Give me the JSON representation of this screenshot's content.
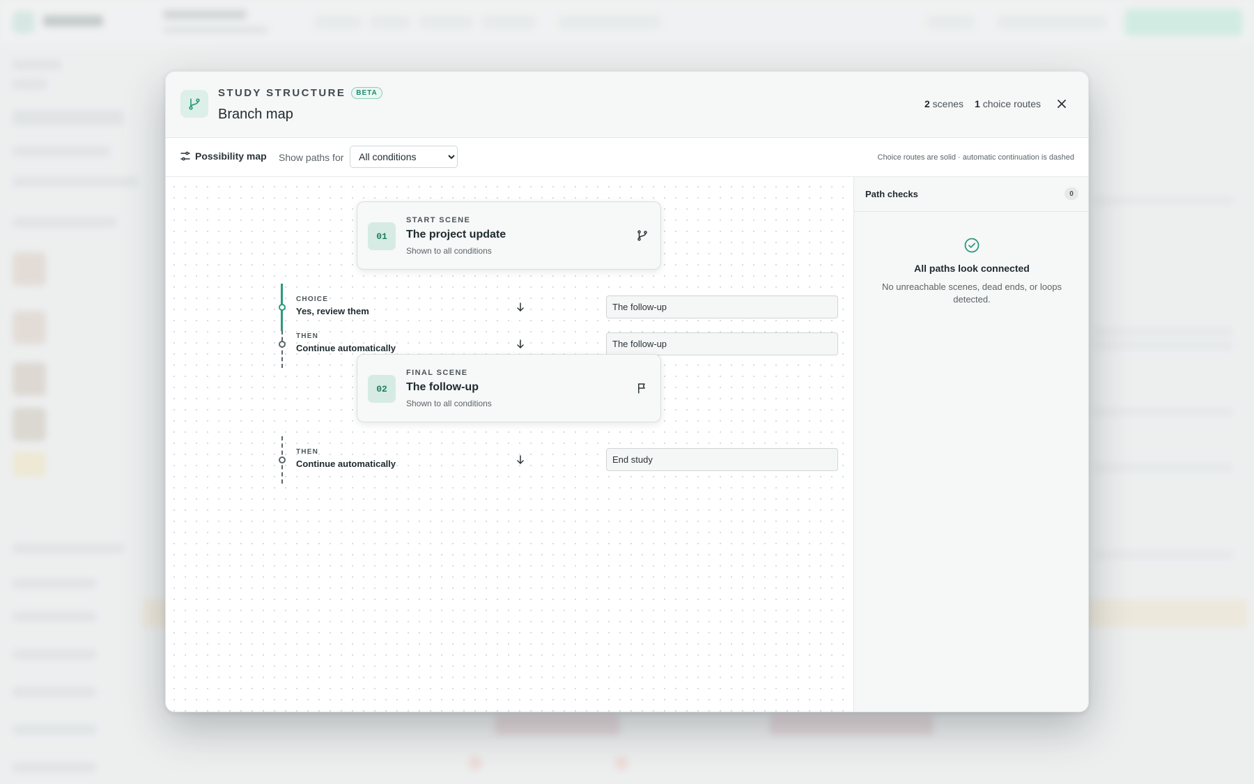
{
  "colors": {
    "accent": "#2a9a7c",
    "accent_soft": "#dcefe8",
    "text": "#1f2a2e",
    "muted": "#5a6468"
  },
  "modal": {
    "icon": "branch-icon",
    "eyebrow": "STUDY STRUCTURE",
    "badge": "BETA",
    "title": "Branch map",
    "stats": {
      "scenes_count": "2",
      "scenes_label": "scenes",
      "routes_count": "1",
      "routes_label": "choice routes"
    },
    "close_icon": "close-icon"
  },
  "toolbar": {
    "map_icon": "sliders-icon",
    "map_label": "Possibility map",
    "filter_label": "Show paths for",
    "filter_selected": "All conditions",
    "filter_options": [
      "All conditions"
    ],
    "legend_hint": "Choice routes are solid · automatic continuation is dashed"
  },
  "canvas": {
    "scenes": [
      {
        "number": "01",
        "kicker": "START SCENE",
        "name": "The project update",
        "subtitle": "Shown to all conditions",
        "icon": "branch-icon",
        "routes": [
          {
            "kind": "CHOICE",
            "label": "Yes, review them",
            "target": "The follow-up",
            "style": "solid"
          },
          {
            "kind": "THEN",
            "label": "Continue automatically",
            "target": "The follow-up",
            "style": "dashed"
          }
        ]
      },
      {
        "number": "02",
        "kicker": "FINAL SCENE",
        "name": "The follow-up",
        "subtitle": "Shown to all conditions",
        "icon": "flag-icon",
        "routes": [
          {
            "kind": "THEN",
            "label": "Continue automatically",
            "target": "End study",
            "style": "dashed"
          }
        ]
      }
    ]
  },
  "panel": {
    "title": "Path checks",
    "count": "0",
    "status_icon": "check-circle-icon",
    "status_title": "All paths look connected",
    "status_desc": "No unreachable scenes, dead ends, or loops detected."
  }
}
